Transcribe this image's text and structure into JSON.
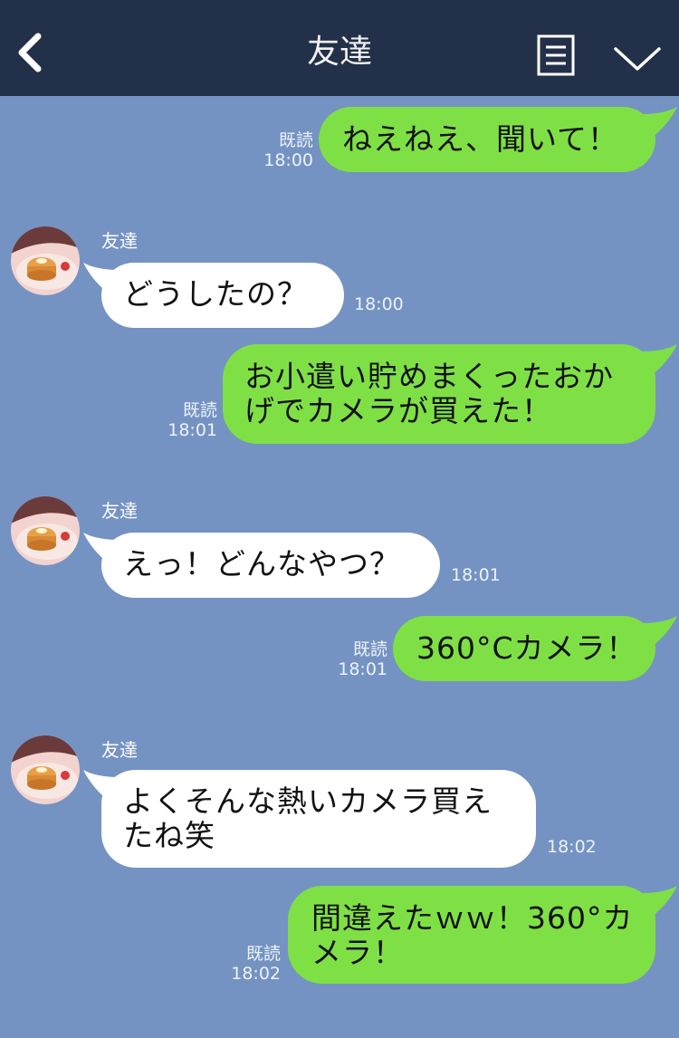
{
  "header": {
    "title": "友達",
    "back_icon": "chevron-left-icon",
    "menu_icon": "note-list-icon",
    "dropdown_icon": "chevron-down-icon"
  },
  "colors": {
    "background": "#7493c3",
    "header": "#233049",
    "outgoing_bubble": "#7fe045",
    "incoming_bubble": "#ffffff"
  },
  "messages": [
    {
      "direction": "out",
      "text": "ねえねえ、聞いて！",
      "read": "既読",
      "time": "18:00"
    },
    {
      "direction": "in",
      "sender": "友達",
      "text": "どうしたの？",
      "time": "18:00"
    },
    {
      "direction": "out",
      "text": "お小遣い貯めまくったおか\nげでカメラが買えた！",
      "read": "既読",
      "time": "18:01"
    },
    {
      "direction": "in",
      "sender": "友達",
      "text": "えっ！どんなやつ？",
      "time": "18:01"
    },
    {
      "direction": "out",
      "text": "360°Cカメラ！",
      "read": "既読",
      "time": "18:01"
    },
    {
      "direction": "in",
      "sender": "友達",
      "text": "よくそんな熱いカメラ買え\nたね笑",
      "time": "18:02"
    },
    {
      "direction": "out",
      "text": "間違えたｗｗ！360°カ\nメラ！",
      "read": "既読",
      "time": "18:02"
    }
  ]
}
